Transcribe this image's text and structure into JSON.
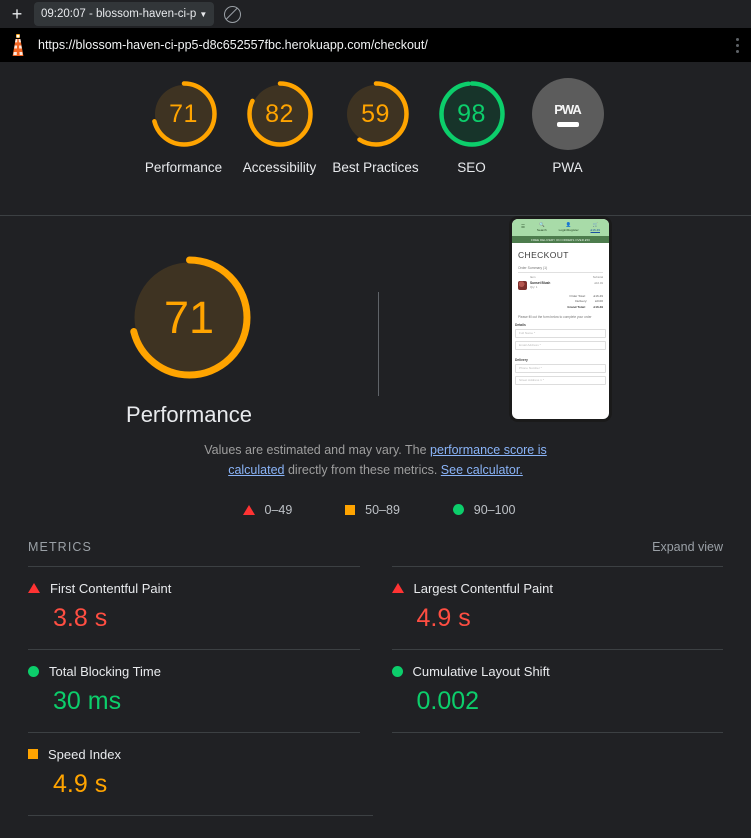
{
  "browser": {
    "new_tab_label": "+",
    "tab_title": "09:20:07 - blossom-haven-ci-p",
    "tab_caret": "▼",
    "block_icon_name": "no-entry-icon",
    "url": "https://blossom-haven-ci-pp5-d8c652557fbc.herokuapp.com/checkout/",
    "menu_icon_name": "three-dot-menu"
  },
  "summary_gauges": [
    {
      "label": "Performance",
      "score": "71",
      "color": "#ffa400",
      "fill": "#3e3322"
    },
    {
      "label": "Accessibility",
      "score": "82",
      "color": "#ffa400",
      "fill": "#3e3322"
    },
    {
      "label": "Best Practices",
      "score": "59",
      "color": "#ffa400",
      "fill": "#3e3322"
    },
    {
      "label": "SEO",
      "score": "98",
      "color": "#0cce6b",
      "fill": "#17342a"
    },
    {
      "label": "PWA",
      "score": "–",
      "color": "#5c5c5c",
      "fill": "#5c5c5c",
      "na": true,
      "badge": "PWA"
    }
  ],
  "performance": {
    "score": "71",
    "title": "Performance",
    "description_part1": "Values are estimated and may vary. The ",
    "link1": "performance score is calculated",
    "description_part2": " directly from these metrics. ",
    "link2": "See calculator.",
    "legend": [
      {
        "shape": "triangle",
        "range": "0–49",
        "color": "#ff3333"
      },
      {
        "shape": "square",
        "range": "50–89",
        "color": "#ffa400"
      },
      {
        "shape": "circle",
        "range": "90–100",
        "color": "#0cce6b"
      }
    ]
  },
  "thumbnail": {
    "nav": [
      {
        "icon": "hamburger-icon",
        "label": ""
      },
      {
        "icon": "search-icon",
        "label": "Search"
      },
      {
        "icon": "user-icon",
        "label": "Login/Register"
      },
      {
        "icon": "cart-icon",
        "label": "£16.49"
      }
    ],
    "banner": "FREE DELIVERY ON ORDERS OVER £50",
    "heading": "CHECKOUT",
    "order_summary_label": "Order Summary (1)",
    "col_item": "Item",
    "col_subtotal": "Subtotal",
    "product_name": "Sunset Blush",
    "product_qty": "Qty: 1",
    "product_price": "£16.49",
    "totals": [
      {
        "label": "Order Total:",
        "value": "£16.49"
      },
      {
        "label": "Delivery:",
        "value": "£0.00"
      },
      {
        "label": "Grand Total:",
        "value": "£16.49"
      }
    ],
    "form_note": "Please fill out the form below to complete your order",
    "section_details": "Details",
    "section_delivery": "Delivery",
    "fields": [
      "Full Name *",
      "Email Address *",
      "Phone Number *",
      "Street Address 1 *"
    ]
  },
  "metrics_section": {
    "title": "METRICS",
    "expand_label": "Expand view",
    "items": [
      {
        "name": "First Contentful Paint",
        "value": "3.8 s",
        "status": "fail",
        "color": "#ff4e42",
        "shape": "triangle"
      },
      {
        "name": "Largest Contentful Paint",
        "value": "4.9 s",
        "status": "fail",
        "color": "#ff4e42",
        "shape": "triangle"
      },
      {
        "name": "Total Blocking Time",
        "value": "30 ms",
        "status": "pass",
        "color": "#0cce6b",
        "shape": "circle"
      },
      {
        "name": "Cumulative Layout Shift",
        "value": "0.002",
        "status": "pass",
        "color": "#0cce6b",
        "shape": "circle"
      },
      {
        "name": "Speed Index",
        "value": "4.9 s",
        "status": "average",
        "color": "#ffa400",
        "shape": "square"
      }
    ]
  }
}
